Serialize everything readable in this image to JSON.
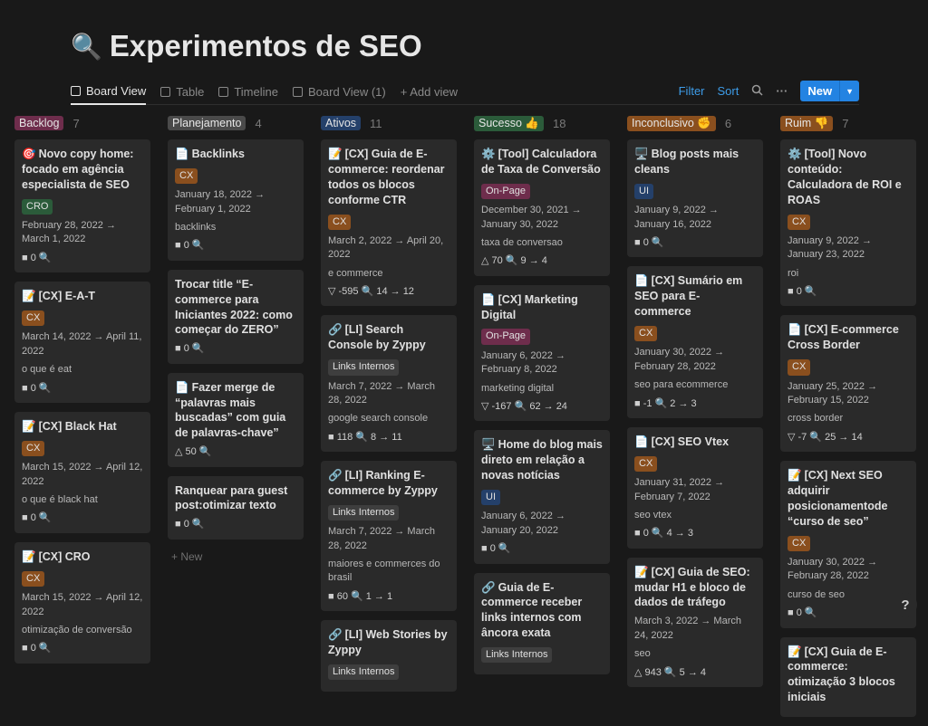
{
  "page": {
    "icon": "🔍",
    "title": "Experimentos de SEO"
  },
  "tabs": [
    {
      "label": "Board View",
      "active": true
    },
    {
      "label": "Table"
    },
    {
      "label": "Timeline"
    },
    {
      "label": "Board View (1)"
    },
    {
      "label": "+ Add view"
    }
  ],
  "toolbar": {
    "filter": "Filter",
    "sort": "Sort",
    "new": "New",
    "more": "···",
    "search_icon": "search-icon"
  },
  "columns": [
    {
      "name": "Backlog",
      "count": "7",
      "color": "#6e2d4c",
      "cards": [
        {
          "emoji": "🎯",
          "title": "Novo copy home: focado em agência especialista de SEO",
          "tag": "CRO",
          "tagclass": "cro",
          "date": "February 28, 2022 → March 1, 2022",
          "metrics": "■ 0 🔍"
        },
        {
          "emoji": "📝",
          "title": "[CX] E-A-T",
          "tag": "CX",
          "tagclass": "cx",
          "date": "March 14, 2022 → April 11, 2022",
          "kw": "o que é eat",
          "metrics": "■ 0 🔍"
        },
        {
          "emoji": "📝",
          "title": "[CX] Black Hat",
          "tag": "CX",
          "tagclass": "cx",
          "date": "March 15, 2022 → April 12, 2022",
          "kw": "o que é black hat",
          "metrics": "■ 0 🔍"
        },
        {
          "emoji": "📝",
          "title": "[CX] CRO",
          "tag": "CX",
          "tagclass": "cx",
          "date": "March 15, 2022 → April 12, 2022",
          "kw": "otimização de conversão",
          "metrics": "■ 0 🔍"
        }
      ]
    },
    {
      "name": "Planejamento",
      "count": "4",
      "color": "#4a4a4a",
      "cards": [
        {
          "emoji": "📄",
          "title": "Backlinks",
          "tag": "CX",
          "tagclass": "cx",
          "date": "January 18, 2022 → February 1, 2022",
          "kw": "backlinks",
          "metrics": "■ 0 🔍"
        },
        {
          "title": "Trocar title “E-commerce para Iniciantes 2022: como começar do ZERO”",
          "metrics": "■ 0 🔍"
        },
        {
          "emoji": "📄",
          "title": "Fazer merge de “palavras mais buscadas” com guia de palavras-chave”",
          "metrics": "△ 50 🔍"
        },
        {
          "title": "Ranquear para guest post:otimizar texto",
          "metrics": "■ 0 🔍"
        }
      ],
      "newlabel": "+ New"
    },
    {
      "name": "Ativos",
      "count": "11",
      "color": "#24406a",
      "cards": [
        {
          "emoji": "📝",
          "title": "[CX] Guia de E-commerce: reordenar todos os blocos conforme CTR",
          "tag": "CX",
          "tagclass": "cx",
          "date": "March 2, 2022 → April 20, 2022",
          "kw": "e commerce",
          "metrics": "▽ -595 🔍 14 → 12"
        },
        {
          "emoji": "🔗",
          "title": "[LI] Search Console by Zyppy",
          "tag": "Links Internos",
          "tagclass": "li",
          "date": "March 7, 2022 → March 28, 2022",
          "kw": "google search console",
          "metrics": "■ 118 🔍 8 → 11"
        },
        {
          "emoji": "🔗",
          "title": "[LI] Ranking E-commerce by Zyppy",
          "tag": "Links Internos",
          "tagclass": "li",
          "date": "March 7, 2022 → March 28, 2022",
          "kw": "maiores e commerces do brasil",
          "metrics": "■ 60 🔍 1 → 1"
        },
        {
          "emoji": "🔗",
          "title": "[LI] Web Stories by Zyppy",
          "tag": "Links Internos",
          "tagclass": "li"
        }
      ]
    },
    {
      "name": "Sucesso 👍",
      "count": "18",
      "color": "#2b5b3a",
      "cards": [
        {
          "emoji": "⚙️",
          "title": "[Tool] Calculadora de Taxa de Conversão",
          "tag": "On-Page",
          "tagclass": "onpage",
          "date": "December 30, 2021 → January 30, 2022",
          "kw": "taxa de conversao",
          "metrics": "△ 70 🔍 9 → 4"
        },
        {
          "emoji": "📄",
          "title": "[CX] Marketing Digital",
          "tag": "On-Page",
          "tagclass": "onpage",
          "date": "January 6, 2022 → February 8, 2022",
          "kw": "marketing digital",
          "metrics": "▽ -167 🔍 62 → 24"
        },
        {
          "emoji": "🖥️",
          "title": "Home do blog mais direto em relação a novas notícias",
          "tag": "UI",
          "tagclass": "ui",
          "date": "January 6, 2022 → January 20, 2022",
          "metrics": "■ 0 🔍"
        },
        {
          "emoji": "🔗",
          "title": "Guia de E-commerce receber links internos com âncora exata",
          "tag": "Links Internos",
          "tagclass": "li"
        }
      ]
    },
    {
      "name": "Inconclusivo ✊",
      "count": "6",
      "color": "#8a4f1e",
      "cards": [
        {
          "emoji": "🖥️",
          "title": "Blog posts mais cleans",
          "tag": "UI",
          "tagclass": "ui",
          "date": "January 9, 2022 → January 16, 2022",
          "metrics": "■ 0 🔍"
        },
        {
          "emoji": "📄",
          "title": "[CX] Sumário em SEO para E-commerce",
          "tag": "CX",
          "tagclass": "cx",
          "date": "January 30, 2022 → February 28, 2022",
          "kw": "seo para ecommerce",
          "metrics": "■ -1 🔍 2 → 3"
        },
        {
          "emoji": "📄",
          "title": "[CX] SEO Vtex",
          "tag": "CX",
          "tagclass": "cx",
          "date": "January 31, 2022 → February 7, 2022",
          "kw": "seo vtex",
          "metrics": "■ 0 🔍 4 → 3"
        },
        {
          "emoji": "📝",
          "title": "[CX] Guia de SEO: mudar H1 e bloco de dados de tráfego",
          "date": "March 3, 2022 → March 24, 2022",
          "kw": "seo",
          "metrics": "△ 943 🔍 5 → 4"
        }
      ]
    },
    {
      "name": "Ruim 👎",
      "count": "7",
      "color": "#8a4f1e",
      "cards": [
        {
          "emoji": "⚙️",
          "title": "[Tool] Novo conteúdo: Calculadora de ROI e ROAS",
          "tag": "CX",
          "tagclass": "cx",
          "date": "January 9, 2022 → January 23, 2022",
          "kw": "roi",
          "metrics": "■ 0 🔍"
        },
        {
          "emoji": "📄",
          "title": "[CX] E-commerce Cross Border",
          "tag": "CX",
          "tagclass": "cx",
          "date": "January 25, 2022 → February 15, 2022",
          "kw": "cross border",
          "metrics": "▽ -7 🔍 25 → 14"
        },
        {
          "emoji": "📝",
          "title": "[CX] Next SEO adquirir posicionamentode “curso de seo”",
          "tag": "CX",
          "tagclass": "cx",
          "date": "January 30, 2022 → February 28, 2022",
          "kw": "curso de seo",
          "metrics": "■ 0 🔍"
        },
        {
          "emoji": "📝",
          "title": "[CX] Guia de E-commerce: otimização 3 blocos iniciais"
        }
      ]
    }
  ],
  "help": "?"
}
